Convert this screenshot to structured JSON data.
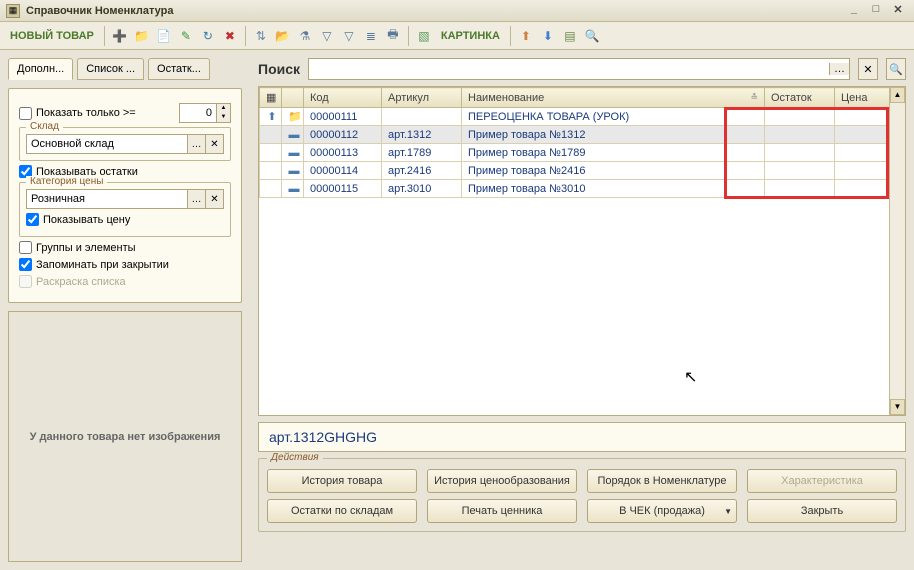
{
  "window": {
    "title": "Справочник Номенклатура"
  },
  "toolbar": {
    "new_item": "НОВЫЙ ТОВАР",
    "picture": "КАРТИНКА"
  },
  "tabs": {
    "t1": "Дополн...",
    "t2": "Список ...",
    "t3": "Остатк..."
  },
  "left": {
    "show_only": "Показать только >=",
    "show_only_value": "0",
    "warehouse_legend": "Склад",
    "warehouse_value": "Основной склад",
    "show_remains": "Показывать остатки",
    "price_category_legend": "Категория цены",
    "price_category_value": "Розничная",
    "show_price": "Показывать цену",
    "groups_elements": "Группы и элементы",
    "remember_on_close": "Запоминать при закрытии",
    "list_coloring": "Раскраска списка",
    "no_image": "У данного товара нет изображения"
  },
  "search": {
    "label": "Поиск",
    "value": ""
  },
  "table": {
    "headers": {
      "code": "Код",
      "article": "Артикул",
      "name": "Наименование",
      "remain": "Остаток",
      "price": "Цена"
    },
    "rows": [
      {
        "icon": "folder",
        "code": "00000111",
        "article": "",
        "name": "ПЕРЕОЦЕНКА ТОВАРА (УРОК)",
        "remain": "",
        "price": "",
        "group": true
      },
      {
        "icon": "item",
        "code": "00000112",
        "article": "арт.1312",
        "name": "Пример товара №1312",
        "remain": "",
        "price": "",
        "selected": true
      },
      {
        "icon": "item",
        "code": "00000113",
        "article": "арт.1789",
        "name": "Пример товара №1789",
        "remain": "",
        "price": ""
      },
      {
        "icon": "item",
        "code": "00000114",
        "article": "арт.2416",
        "name": "Пример товара №2416",
        "remain": "",
        "price": ""
      },
      {
        "icon": "item",
        "code": "00000115",
        "article": "арт.3010",
        "name": "Пример товара №3010",
        "remain": "",
        "price": ""
      }
    ]
  },
  "detail": "арт.1312GHGHG",
  "actions": {
    "legend": "Действия",
    "history": "История товара",
    "pricing_history": "История ценообразования",
    "order_in_nomenclature": "Порядок в Номенклатуре",
    "characteristic": "Характеристика",
    "stock_by_warehouse": "Остатки по складам",
    "print_price_tag": "Печать ценника",
    "to_check": "В ЧЕК (продажа)",
    "close": "Закрыть"
  }
}
